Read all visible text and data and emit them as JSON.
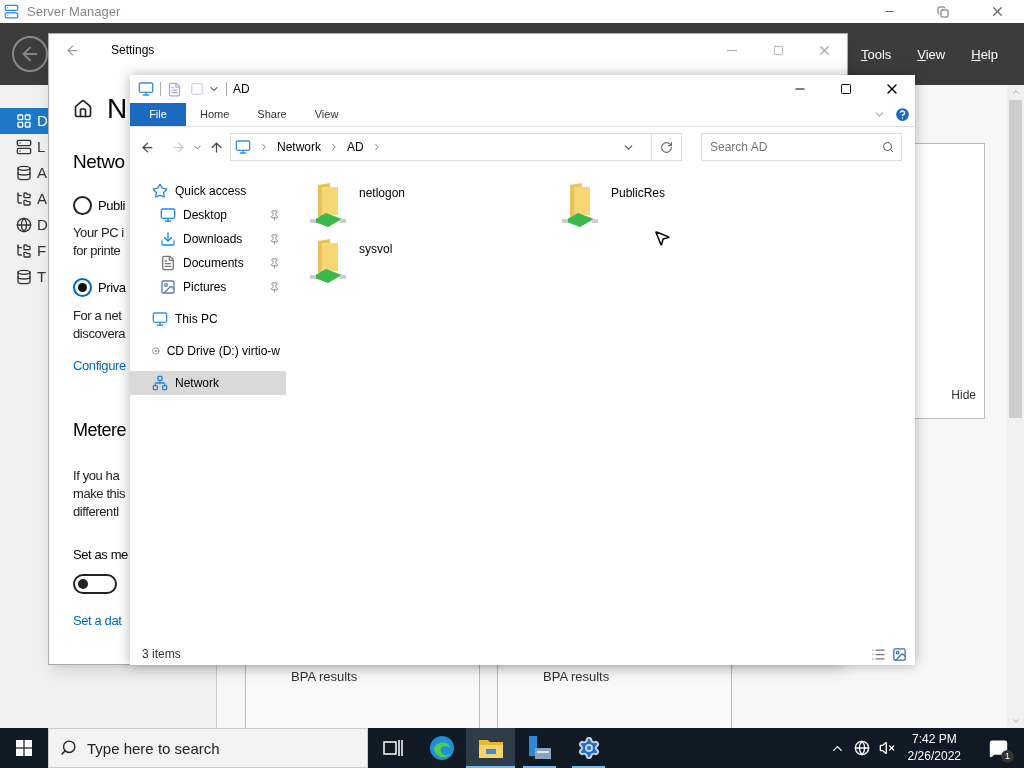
{
  "server_manager": {
    "title": "Server Manager",
    "menu": [
      "Tools",
      "View",
      "Help"
    ],
    "nav_items": [
      {
        "label": "D",
        "kind": "dashboard",
        "selected": true
      },
      {
        "label": "L",
        "kind": "server",
        "selected": false
      },
      {
        "label": "A",
        "kind": "servers",
        "selected": false
      },
      {
        "label": "A",
        "kind": "directory",
        "selected": false
      },
      {
        "label": "D",
        "kind": "dns",
        "selected": false
      },
      {
        "label": "F",
        "kind": "files",
        "selected": false
      },
      {
        "label": "T",
        "kind": "servers",
        "selected": false
      }
    ],
    "panel_action": "Hide",
    "tiles": [
      "BPA results",
      "BPA results"
    ]
  },
  "settings": {
    "title": "Settings",
    "page_heading": "N",
    "section_heading": "Netwo",
    "profiles": [
      {
        "label": "Publi",
        "description": [
          "Your PC i",
          "for printe"
        ],
        "selected": false
      },
      {
        "label": "Priva",
        "description": [
          "For a net",
          "discovera"
        ],
        "selected": true
      }
    ],
    "configure_link": "Configure",
    "metered": {
      "heading": "Metere",
      "description": [
        "If you ha",
        "make this",
        "differentl"
      ],
      "toggle_label": "Set as me",
      "on": false,
      "link": "Set a dat"
    }
  },
  "explorer": {
    "title": "AD",
    "ribbon_tabs": [
      {
        "label": "File",
        "selected": true
      },
      {
        "label": "Home",
        "selected": false
      },
      {
        "label": "Share",
        "selected": false
      },
      {
        "label": "View",
        "selected": false
      }
    ],
    "breadcrumb": [
      "Network",
      "AD"
    ],
    "search": {
      "placeholder": "Search AD"
    },
    "nav": [
      {
        "label": "Quick access",
        "kind": "star",
        "selected": false,
        "children": [
          {
            "label": "Desktop",
            "kind": "desktop",
            "pinned": true
          },
          {
            "label": "Downloads",
            "kind": "download",
            "pinned": true
          },
          {
            "label": "Documents",
            "kind": "document",
            "pinned": true
          },
          {
            "label": "Pictures",
            "kind": "picture",
            "pinned": true
          }
        ]
      },
      {
        "label": "This PC",
        "kind": "pc",
        "selected": false
      },
      {
        "label": "CD Drive (D:) virtio-w",
        "kind": "cd",
        "selected": false
      },
      {
        "label": "Network",
        "kind": "network",
        "selected": true
      }
    ],
    "items": [
      "netlogon",
      "PublicRes",
      "sysvol"
    ],
    "status": "3 items"
  },
  "taskbar": {
    "search": {
      "placeholder": "Type here to search"
    },
    "apps": [
      {
        "kind": "task-view",
        "open": false,
        "active": false
      },
      {
        "kind": "edge",
        "open": false,
        "active": false
      },
      {
        "kind": "explorer",
        "open": true,
        "active": true
      },
      {
        "kind": "server-manager",
        "open": true,
        "active": false
      },
      {
        "kind": "settings",
        "open": true,
        "active": false
      }
    ],
    "time": "7:42 PM",
    "date": "2/26/2022",
    "notification_count": "1"
  }
}
